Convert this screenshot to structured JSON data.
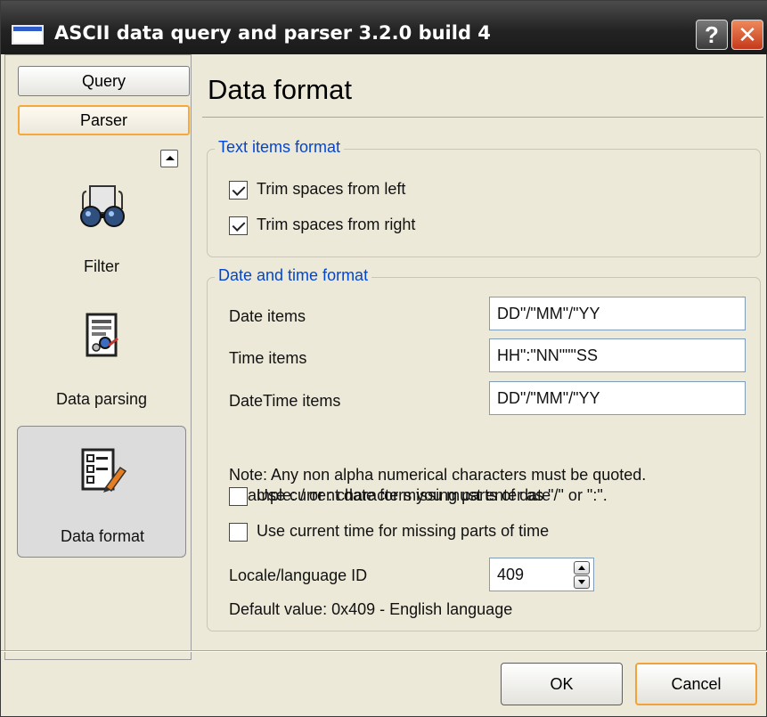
{
  "window": {
    "title": "ASCII data query and parser 3.2.0 build 4",
    "help_label": "?",
    "close_label": "✕"
  },
  "sidebar": {
    "tabs": [
      {
        "label": "Query"
      },
      {
        "label": "Parser",
        "active": true
      }
    ],
    "items": [
      {
        "label": "Filter",
        "icon": "glasses-icon"
      },
      {
        "label": "Data parsing",
        "icon": "parsing-document-icon"
      },
      {
        "label": "Data format",
        "icon": "format-list-pen-icon",
        "selected": true
      }
    ]
  },
  "main": {
    "title": "Data format",
    "text_format": {
      "caption": "Text items format",
      "trim_left": {
        "label": "Trim spaces from left",
        "checked": true
      },
      "trim_right": {
        "label": "Trim spaces from right",
        "checked": true
      }
    },
    "datetime_format": {
      "caption": "Date and time format",
      "date_items": {
        "label": "Date items",
        "value": "DD\"/\"MM\"/\"YY"
      },
      "time_items": {
        "label": "Time items",
        "value": "HH\":\"NN\"\"\"SS"
      },
      "datetime_items": {
        "label": "DateTime items",
        "value": "DD\"/\"MM\"/\"YY"
      },
      "note_line1": "Note: Any non alpha numerical characters must be quoted.",
      "note_line2": "Example: / or : characters you must enter as \"/\" or \":\".",
      "use_current_date": {
        "label": "Use current date for missing parts of date",
        "checked": false
      },
      "use_current_time": {
        "label": "Use current time for missing parts of time",
        "checked": false
      },
      "locale": {
        "label": "Locale/language ID",
        "value": "409"
      },
      "default_note": "Default value: 0x409 - English language"
    }
  },
  "footer": {
    "ok_label": "OK",
    "cancel_label": "Cancel"
  },
  "colors": {
    "titlebar": "#2a2a2a",
    "group_caption": "#0046d5",
    "focus_border": "#f6a83a",
    "close_button": "#d9502c"
  }
}
